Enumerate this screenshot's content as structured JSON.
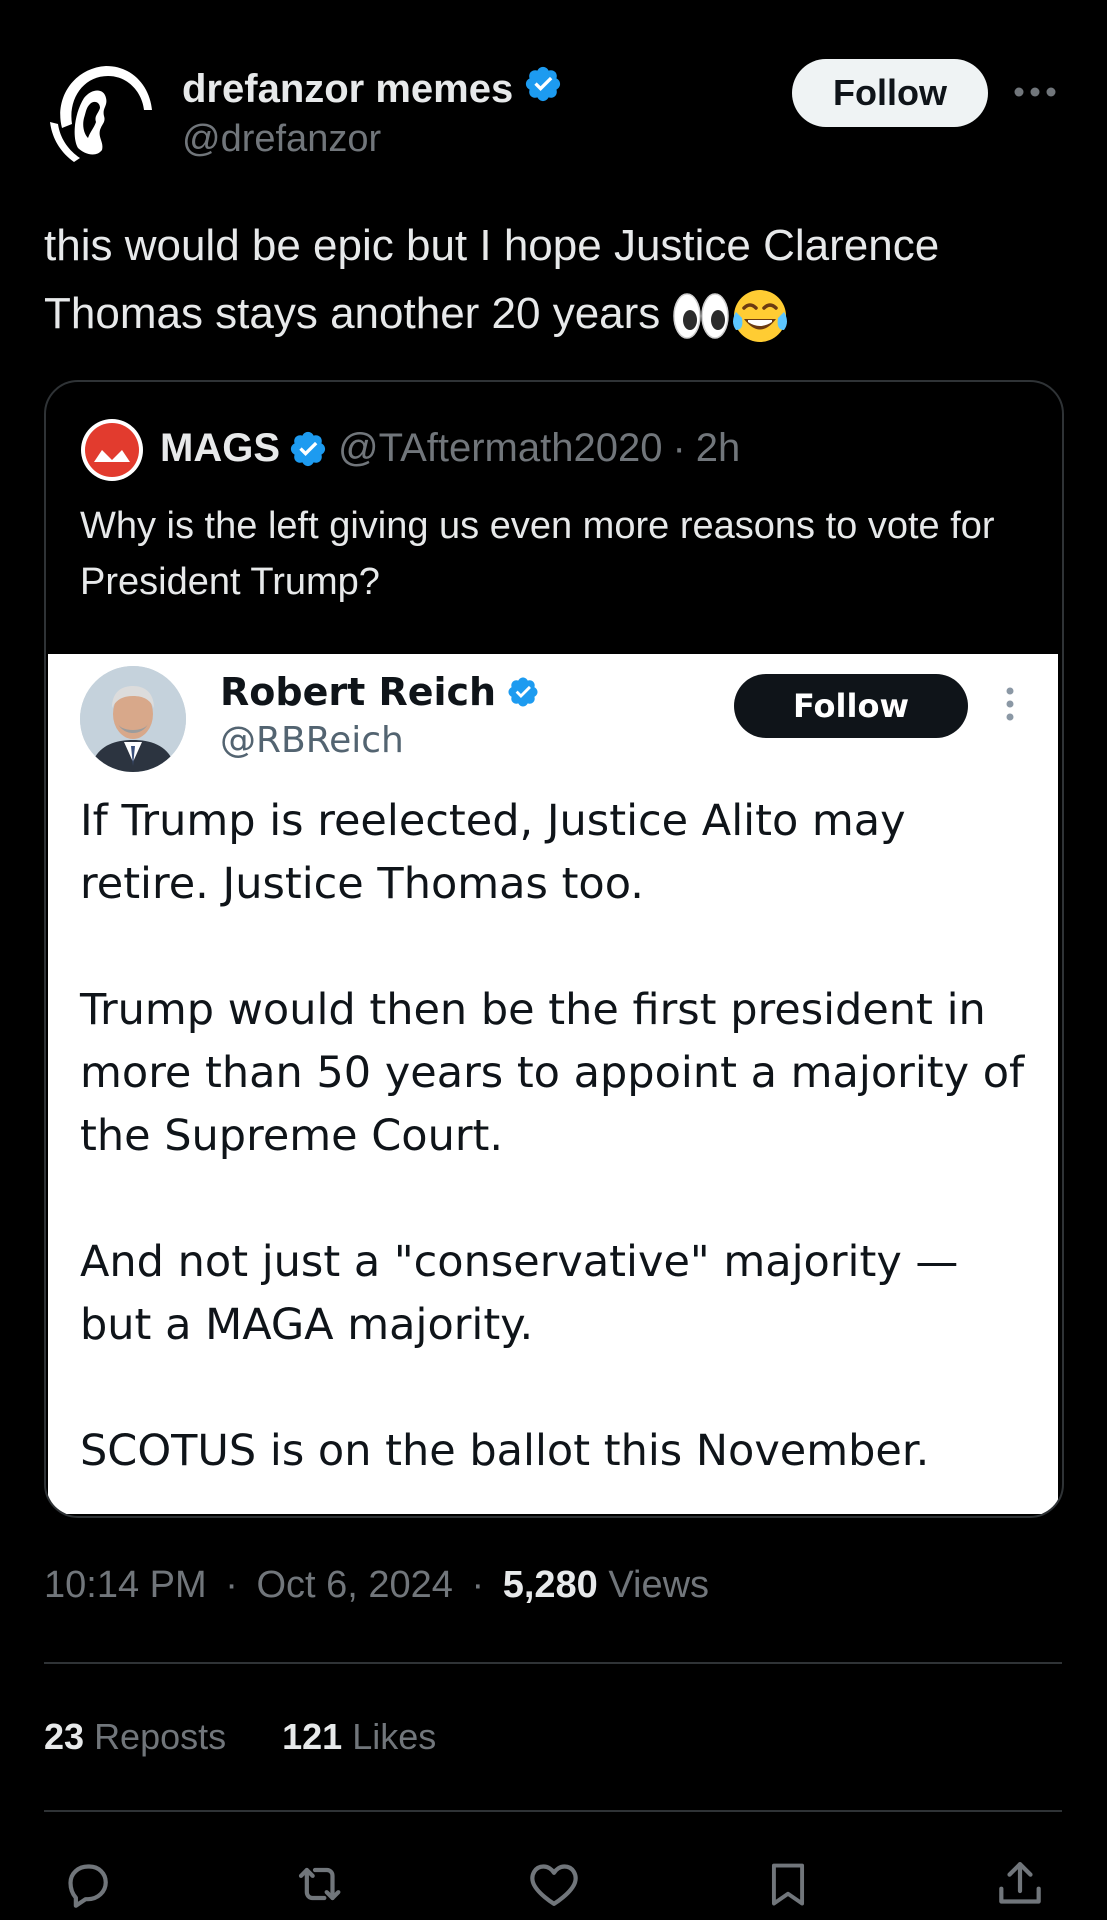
{
  "author": {
    "display_name": "drefanzor memes",
    "handle": "@drefanzor",
    "verified": true,
    "avatar_icon": "silhouette-profile-avatar"
  },
  "header": {
    "follow_label": "Follow",
    "more_icon": "more-horizontal-icon"
  },
  "tweet": {
    "text": "this would be epic but I hope Justice Clarence Thomas stays another 20 years",
    "emojis": [
      "👀",
      "😂"
    ]
  },
  "quote": {
    "display_name": "MAGS",
    "verified": true,
    "handle": "@TAftermath2020",
    "separator": "·",
    "time": "2h",
    "text": "Why is the left giving us even more reasons to vote for President Trump?",
    "embed": {
      "display_name": "Robert Reich",
      "handle": "@RBReich",
      "verified": true,
      "follow_label": "Follow",
      "paragraphs": [
        "If Trump is reelected, Justice Alito may retire. Justice Thomas too.",
        "Trump would then be the first president in more than 50 years to appoint a majority of the Supreme Court.",
        "And not just a \"conservative\" majority — but a MAGA majority.",
        "SCOTUS is on the ballot this November."
      ]
    }
  },
  "meta": {
    "time": "10:14 PM",
    "date": "Oct 6, 2024",
    "separator": "·",
    "views_count": "5,280",
    "views_label": "Views"
  },
  "stats": {
    "reposts_count": "23",
    "reposts_label": "Reposts",
    "likes_count": "121",
    "likes_label": "Likes"
  },
  "actions": [
    "reply-icon",
    "repost-icon",
    "like-icon",
    "bookmark-icon",
    "share-icon"
  ],
  "colors": {
    "background": "#000000",
    "text_primary": "#e7e9ea",
    "text_secondary": "#71767b",
    "verified_blue": "#1d9bf0",
    "divider": "#2f3336"
  }
}
